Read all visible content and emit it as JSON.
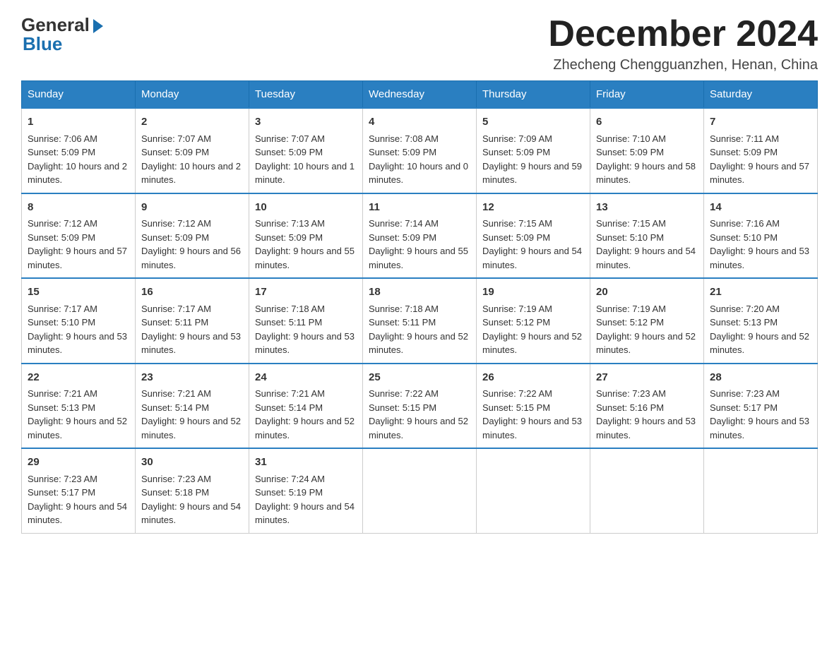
{
  "header": {
    "logo_general": "General",
    "logo_blue": "Blue",
    "month_title": "December 2024",
    "subtitle": "Zhecheng Chengguanzhen, Henan, China"
  },
  "weekdays": [
    "Sunday",
    "Monday",
    "Tuesday",
    "Wednesday",
    "Thursday",
    "Friday",
    "Saturday"
  ],
  "weeks": [
    [
      {
        "day": "1",
        "sunrise": "7:06 AM",
        "sunset": "5:09 PM",
        "daylight": "10 hours and 2 minutes."
      },
      {
        "day": "2",
        "sunrise": "7:07 AM",
        "sunset": "5:09 PM",
        "daylight": "10 hours and 2 minutes."
      },
      {
        "day": "3",
        "sunrise": "7:07 AM",
        "sunset": "5:09 PM",
        "daylight": "10 hours and 1 minute."
      },
      {
        "day": "4",
        "sunrise": "7:08 AM",
        "sunset": "5:09 PM",
        "daylight": "10 hours and 0 minutes."
      },
      {
        "day": "5",
        "sunrise": "7:09 AM",
        "sunset": "5:09 PM",
        "daylight": "9 hours and 59 minutes."
      },
      {
        "day": "6",
        "sunrise": "7:10 AM",
        "sunset": "5:09 PM",
        "daylight": "9 hours and 58 minutes."
      },
      {
        "day": "7",
        "sunrise": "7:11 AM",
        "sunset": "5:09 PM",
        "daylight": "9 hours and 57 minutes."
      }
    ],
    [
      {
        "day": "8",
        "sunrise": "7:12 AM",
        "sunset": "5:09 PM",
        "daylight": "9 hours and 57 minutes."
      },
      {
        "day": "9",
        "sunrise": "7:12 AM",
        "sunset": "5:09 PM",
        "daylight": "9 hours and 56 minutes."
      },
      {
        "day": "10",
        "sunrise": "7:13 AM",
        "sunset": "5:09 PM",
        "daylight": "9 hours and 55 minutes."
      },
      {
        "day": "11",
        "sunrise": "7:14 AM",
        "sunset": "5:09 PM",
        "daylight": "9 hours and 55 minutes."
      },
      {
        "day": "12",
        "sunrise": "7:15 AM",
        "sunset": "5:09 PM",
        "daylight": "9 hours and 54 minutes."
      },
      {
        "day": "13",
        "sunrise": "7:15 AM",
        "sunset": "5:10 PM",
        "daylight": "9 hours and 54 minutes."
      },
      {
        "day": "14",
        "sunrise": "7:16 AM",
        "sunset": "5:10 PM",
        "daylight": "9 hours and 53 minutes."
      }
    ],
    [
      {
        "day": "15",
        "sunrise": "7:17 AM",
        "sunset": "5:10 PM",
        "daylight": "9 hours and 53 minutes."
      },
      {
        "day": "16",
        "sunrise": "7:17 AM",
        "sunset": "5:11 PM",
        "daylight": "9 hours and 53 minutes."
      },
      {
        "day": "17",
        "sunrise": "7:18 AM",
        "sunset": "5:11 PM",
        "daylight": "9 hours and 53 minutes."
      },
      {
        "day": "18",
        "sunrise": "7:18 AM",
        "sunset": "5:11 PM",
        "daylight": "9 hours and 52 minutes."
      },
      {
        "day": "19",
        "sunrise": "7:19 AM",
        "sunset": "5:12 PM",
        "daylight": "9 hours and 52 minutes."
      },
      {
        "day": "20",
        "sunrise": "7:19 AM",
        "sunset": "5:12 PM",
        "daylight": "9 hours and 52 minutes."
      },
      {
        "day": "21",
        "sunrise": "7:20 AM",
        "sunset": "5:13 PM",
        "daylight": "9 hours and 52 minutes."
      }
    ],
    [
      {
        "day": "22",
        "sunrise": "7:21 AM",
        "sunset": "5:13 PM",
        "daylight": "9 hours and 52 minutes."
      },
      {
        "day": "23",
        "sunrise": "7:21 AM",
        "sunset": "5:14 PM",
        "daylight": "9 hours and 52 minutes."
      },
      {
        "day": "24",
        "sunrise": "7:21 AM",
        "sunset": "5:14 PM",
        "daylight": "9 hours and 52 minutes."
      },
      {
        "day": "25",
        "sunrise": "7:22 AM",
        "sunset": "5:15 PM",
        "daylight": "9 hours and 52 minutes."
      },
      {
        "day": "26",
        "sunrise": "7:22 AM",
        "sunset": "5:15 PM",
        "daylight": "9 hours and 53 minutes."
      },
      {
        "day": "27",
        "sunrise": "7:23 AM",
        "sunset": "5:16 PM",
        "daylight": "9 hours and 53 minutes."
      },
      {
        "day": "28",
        "sunrise": "7:23 AM",
        "sunset": "5:17 PM",
        "daylight": "9 hours and 53 minutes."
      }
    ],
    [
      {
        "day": "29",
        "sunrise": "7:23 AM",
        "sunset": "5:17 PM",
        "daylight": "9 hours and 54 minutes."
      },
      {
        "day": "30",
        "sunrise": "7:23 AM",
        "sunset": "5:18 PM",
        "daylight": "9 hours and 54 minutes."
      },
      {
        "day": "31",
        "sunrise": "7:24 AM",
        "sunset": "5:19 PM",
        "daylight": "9 hours and 54 minutes."
      },
      null,
      null,
      null,
      null
    ]
  ]
}
